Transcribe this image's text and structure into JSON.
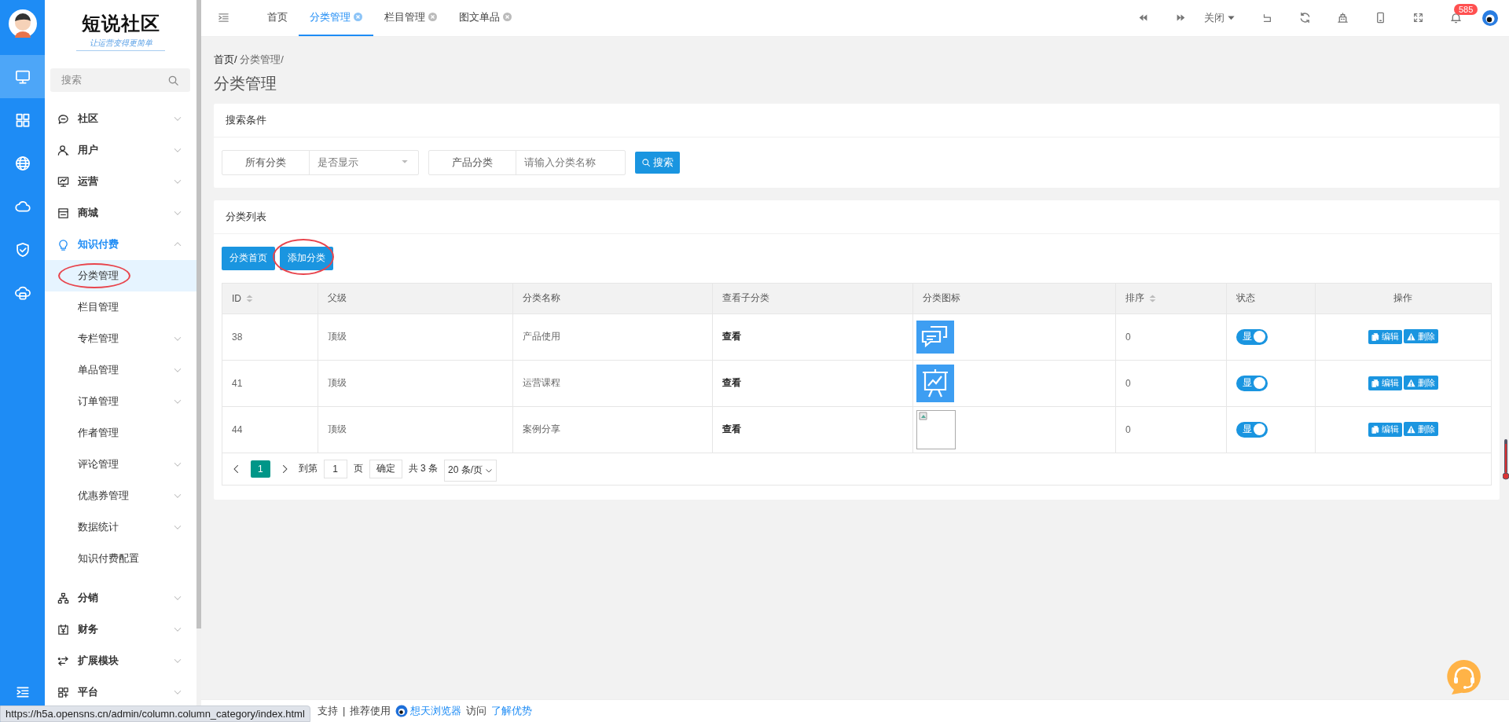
{
  "rail": {
    "items": [
      {
        "kind": "monitor",
        "selected": true
      },
      {
        "kind": "grid",
        "selected": false
      },
      {
        "kind": "globe",
        "selected": false
      },
      {
        "kind": "cloud",
        "selected": false
      },
      {
        "kind": "shield",
        "selected": false
      },
      {
        "kind": "cloud-box",
        "selected": false
      }
    ]
  },
  "sidebar": {
    "logo": "短说社区",
    "slogan": "让运营变得更简单",
    "search": {
      "placeholder": "搜索"
    },
    "menu": [
      {
        "label": "社区",
        "kind": "chat",
        "expanded": false
      },
      {
        "label": "用户",
        "kind": "user",
        "expanded": false
      },
      {
        "label": "运营",
        "kind": "board",
        "expanded": false
      },
      {
        "label": "商城",
        "kind": "store",
        "expanded": false
      },
      {
        "label": "知识付费",
        "kind": "bulb",
        "expanded": true,
        "children": [
          {
            "label": "分类管理",
            "selected": true,
            "submenu": false,
            "annotated": true
          },
          {
            "label": "栏目管理",
            "selected": false,
            "submenu": false,
            "annotated": false
          },
          {
            "label": "专栏管理",
            "selected": false,
            "submenu": true,
            "annotated": false
          },
          {
            "label": "单品管理",
            "selected": false,
            "submenu": true,
            "annotated": false
          },
          {
            "label": "订单管理",
            "selected": false,
            "submenu": true,
            "annotated": false
          },
          {
            "label": "作者管理",
            "selected": false,
            "submenu": false,
            "annotated": false
          },
          {
            "label": "评论管理",
            "selected": false,
            "submenu": true,
            "annotated": false
          },
          {
            "label": "优惠券管理",
            "selected": false,
            "submenu": true,
            "annotated": false
          },
          {
            "label": "数据统计",
            "selected": false,
            "submenu": true,
            "annotated": false
          },
          {
            "label": "知识付费配置",
            "selected": false,
            "submenu": false,
            "annotated": false
          }
        ]
      },
      {
        "label": "分销",
        "kind": "sitemap",
        "expanded": false
      },
      {
        "label": "财务",
        "kind": "yen",
        "expanded": false
      },
      {
        "label": "扩展模块",
        "kind": "arrows",
        "expanded": false
      },
      {
        "label": "平台",
        "kind": "apps",
        "expanded": false
      }
    ]
  },
  "topbar": {
    "tabs": [
      {
        "label": "首页",
        "selected": false,
        "closable": false
      },
      {
        "label": "分类管理",
        "selected": true,
        "closable": true
      },
      {
        "label": "栏目管理",
        "selected": false,
        "closable": true
      },
      {
        "label": "图文单品",
        "selected": false,
        "closable": true
      }
    ],
    "close_menu": "关闭",
    "notifications": "585"
  },
  "page": {
    "breadcrumb": [
      "首页/",
      "分类管理/"
    ],
    "title": "分类管理",
    "search_panel": {
      "title": "搜索条件",
      "filters": [
        {
          "label": "所有分类",
          "kind": "select",
          "placeholder": "是否显示"
        },
        {
          "label": "产品分类",
          "kind": "text",
          "placeholder": "请输入分类名称"
        }
      ],
      "button": "搜索"
    },
    "list_panel": {
      "title": "分类列表",
      "buttons": [
        {
          "label": "分类首页",
          "annotated": false
        },
        {
          "label": "添加分类",
          "annotated": true
        }
      ],
      "table": {
        "columns": [
          {
            "label": "ID",
            "sortable": true
          },
          {
            "label": "父级",
            "sortable": false
          },
          {
            "label": "分类名称",
            "sortable": false
          },
          {
            "label": "查看子分类",
            "sortable": false
          },
          {
            "label": "分类图标",
            "sortable": false
          },
          {
            "label": "排序",
            "sortable": true
          },
          {
            "label": "状态",
            "sortable": false
          },
          {
            "label": "操作",
            "sortable": false
          }
        ],
        "rows": [
          {
            "id": "38",
            "parent": "顶级",
            "name": "产品使用",
            "view": "查看",
            "kind": "chat",
            "sort": "0",
            "status": "显",
            "status_on": true,
            "actions": [
              "编辑",
              "删除"
            ]
          },
          {
            "id": "41",
            "parent": "顶级",
            "name": "运营课程",
            "view": "查看",
            "kind": "chart",
            "sort": "0",
            "status": "显",
            "status_on": true,
            "actions": [
              "编辑",
              "删除"
            ]
          },
          {
            "id": "44",
            "parent": "顶级",
            "name": "案例分享",
            "view": "查看",
            "kind": "broken",
            "sort": "0",
            "status": "显",
            "status_on": true,
            "actions": [
              "编辑",
              "删除"
            ]
          }
        ]
      },
      "pagination": {
        "current": "1",
        "goto": "到第",
        "page_input": "1",
        "unit": "页",
        "confirm": "确定",
        "total": "共 3 条",
        "page_size": "20 条/页"
      }
    }
  },
  "footer": {
    "items": [
      {
        "kind": "text",
        "text": "支持"
      },
      {
        "kind": "text",
        "text": "|"
      },
      {
        "kind": "text",
        "text": "推荐使用"
      },
      {
        "kind": "browser-link",
        "text": "想天浏览器"
      },
      {
        "kind": "text",
        "text": "访问"
      },
      {
        "kind": "link",
        "text": "了解优势"
      }
    ]
  },
  "status_url": "https://h5a.opensns.cn/admin/column.column_category/index.html"
}
